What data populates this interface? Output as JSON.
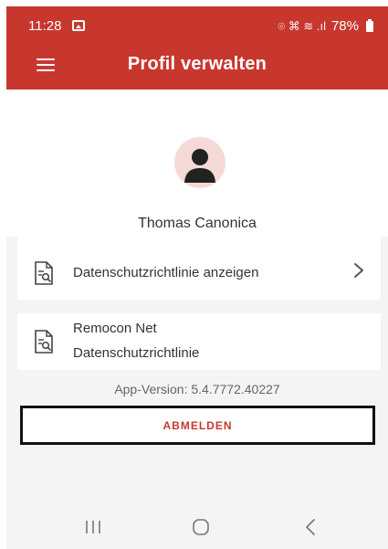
{
  "status_bar": {
    "time": "11:28",
    "right_icons": "⌾ ⌘ ≋ .ıl",
    "battery": "78%"
  },
  "header": {
    "title": "Profil verwalten",
    "menu_icon": "hamburger-menu-icon"
  },
  "profile": {
    "name": "Thomas Canonica",
    "avatar_icon": "user-avatar-icon"
  },
  "items": [
    {
      "label": "Datenschutzrichtlinie anzeigen",
      "icon": "document-search-icon",
      "has_chevron": true
    },
    {
      "label_line1": "Remocon Net",
      "label_line2": "Datenschutzrichtlinie",
      "icon": "document-search-icon"
    }
  ],
  "app_version": "App-Version: 5.4.7772.40227",
  "logout_label": "ABMELDEN",
  "nav": {
    "recent_icon": "recent-apps-icon",
    "home_icon": "home-icon",
    "back_icon": "back-icon"
  },
  "colors": {
    "brand_red": "#c8372e",
    "avatar_bg": "#f5d9d6",
    "background": "#f4f4f4"
  }
}
